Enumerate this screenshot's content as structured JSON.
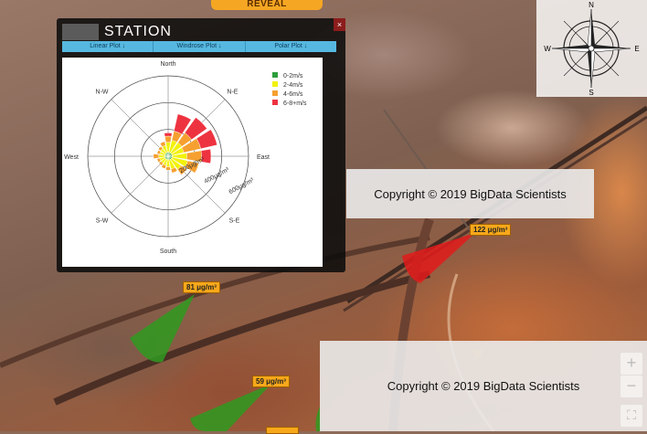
{
  "toolbar": {
    "reveal_label": "REVEAL"
  },
  "station": {
    "title": "STATION",
    "close_label": "×",
    "tabs": [
      {
        "label": "Linear Plot ↓"
      },
      {
        "label": "Windrose Plot ↓"
      },
      {
        "label": "Polar Plot ↓"
      }
    ]
  },
  "chart_data": {
    "type": "windrose",
    "directions": [
      "North",
      "N-E",
      "East",
      "S-E",
      "South",
      "S-W",
      "West",
      "N-W"
    ],
    "radial_ticks": [
      "200μg/m³",
      "400μg/m³",
      "600μg/m³"
    ],
    "rmax": 600,
    "legend_position": "top-right",
    "series": [
      {
        "name": "0-2m/s",
        "color": "#2e9e3e"
      },
      {
        "name": "2-4m/s",
        "color": "#f2f20a"
      },
      {
        "name": "4-6m/s",
        "color": "#f5a030"
      },
      {
        "name": "6-8+m/s",
        "color": "#ee3340"
      }
    ],
    "sectors": [
      {
        "angle": 0,
        "values": [
          30,
          75,
          45,
          25
        ]
      },
      {
        "angle": 22.5,
        "values": [
          28,
          95,
          70,
          130
        ]
      },
      {
        "angle": 45,
        "values": [
          30,
          95,
          90,
          140
        ]
      },
      {
        "angle": 67.5,
        "values": [
          30,
          90,
          130,
          125
        ]
      },
      {
        "angle": 90,
        "values": [
          30,
          110,
          110,
          70
        ]
      },
      {
        "angle": 112.5,
        "values": [
          30,
          120,
          85,
          0
        ]
      },
      {
        "angle": 135,
        "values": [
          30,
          90,
          50,
          0
        ]
      },
      {
        "angle": 157.5,
        "values": [
          28,
          70,
          30,
          0
        ]
      },
      {
        "angle": 180,
        "values": [
          25,
          55,
          25,
          0
        ]
      },
      {
        "angle": 202.5,
        "values": [
          25,
          45,
          25,
          0
        ]
      },
      {
        "angle": 225,
        "values": [
          25,
          40,
          20,
          0
        ]
      },
      {
        "angle": 247.5,
        "values": [
          25,
          40,
          20,
          0
        ]
      },
      {
        "angle": 270,
        "values": [
          25,
          45,
          40,
          0
        ]
      },
      {
        "angle": 292.5,
        "values": [
          25,
          40,
          20,
          0
        ]
      },
      {
        "angle": 315,
        "values": [
          25,
          45,
          20,
          0
        ]
      },
      {
        "angle": 337.5,
        "values": [
          28,
          55,
          30,
          0
        ]
      }
    ]
  },
  "compass": {
    "n": "N",
    "s": "S",
    "e": "E",
    "w": "W"
  },
  "markers": [
    {
      "label": "122 μg/m³",
      "status_color": "#e02020"
    },
    {
      "label": "81 μg/m³",
      "status_color": "#3a9c1e"
    },
    {
      "label": "59 μg/m³",
      "status_color": "#3a9c1e"
    }
  ],
  "map": {
    "copyright": "Copyright © 2019 BigData Scientists",
    "zoom_in": "+",
    "zoom_out": "−",
    "fullscreen": "⛶"
  }
}
